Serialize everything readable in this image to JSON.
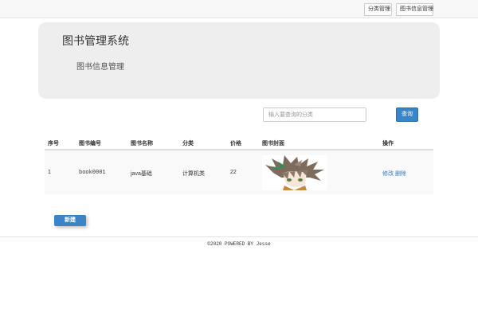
{
  "nav": {
    "category_manage": "分类管理",
    "book_info_manage": "图书信息管理"
  },
  "header": {
    "title": "图书管理系统",
    "subtitle": "图书信息管理"
  },
  "search": {
    "placeholder": "输入要查询的分类",
    "button": "查询"
  },
  "table": {
    "columns": [
      "序号",
      "图书编号",
      "图书名称",
      "分类",
      "价格",
      "图书封面",
      "操作"
    ],
    "rows": [
      {
        "index": "1",
        "book_no": "book0001",
        "name": "java基础",
        "category": "计算机类",
        "price": "22",
        "edit": "修改",
        "delete": "删除"
      }
    ]
  },
  "actions": {
    "new_button": "新建"
  },
  "footer": {
    "text": "©2020 POWERED BY Jesse"
  }
}
